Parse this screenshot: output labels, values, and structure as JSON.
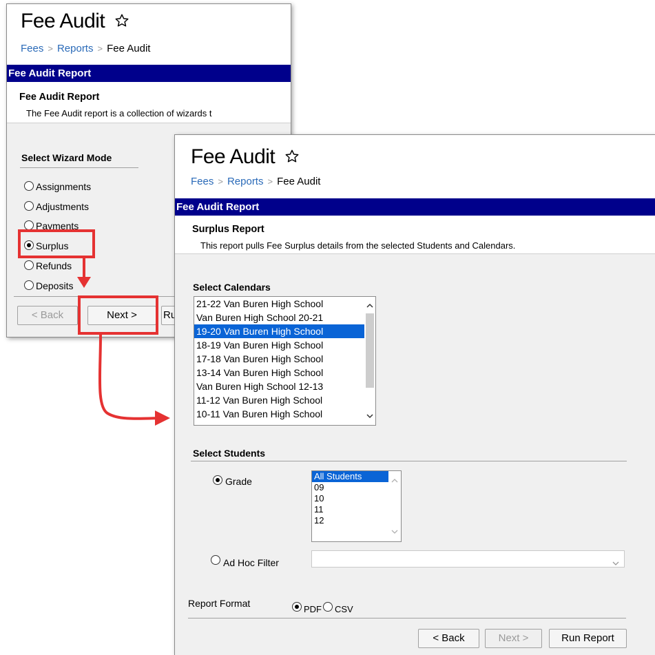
{
  "wizard": {
    "title": "Fee Audit",
    "breadcrumb": [
      "Fees",
      "Reports",
      "Fee Audit"
    ],
    "bar_title": "Fee Audit Report",
    "heading": "Fee Audit Report",
    "description": "The Fee Audit report is a collection of wizards t",
    "mode_label": "Select Wizard Mode",
    "modes": [
      "Assignments",
      "Adjustments",
      "Payments",
      "Surplus",
      "Refunds",
      "Deposits"
    ],
    "selected_mode": "Surplus",
    "back_label": "< Back",
    "next_label": "Next >",
    "run_label": "Ru"
  },
  "surplus": {
    "title": "Fee Audit",
    "breadcrumb": [
      "Fees",
      "Reports",
      "Fee Audit"
    ],
    "bar_title": "Fee Audit Report",
    "heading": "Surplus Report",
    "description": "This report pulls Fee Surplus details from the selected Students and Calendars.",
    "calendars_label": "Select Calendars",
    "calendars": [
      "21-22 Van Buren High School",
      "Van Buren High School 20-21",
      "19-20 Van Buren High School",
      "18-19 Van Buren High School",
      "17-18 Van Buren High School",
      "13-14 Van Buren High School",
      "Van Buren High School 12-13",
      "11-12 Van Buren High School",
      "10-11 Van Buren High School"
    ],
    "selected_calendar": "19-20 Van Buren High School",
    "students_label": "Select Students",
    "grade_label": "Grade",
    "grades": [
      "All Students",
      "09",
      "10",
      "11",
      "12"
    ],
    "selected_grade": "All Students",
    "adhoc_label": "Ad Hoc Filter",
    "format_label": "Report Format",
    "format_options": [
      "PDF",
      "CSV"
    ],
    "selected_format": "PDF",
    "back_label": "< Back",
    "next_label": "Next >",
    "run_label": "Run Report"
  },
  "colors": {
    "header_bar": "#00008b",
    "link": "#2a6ab8",
    "highlight": "#e53232",
    "selection": "#0a64d6"
  }
}
